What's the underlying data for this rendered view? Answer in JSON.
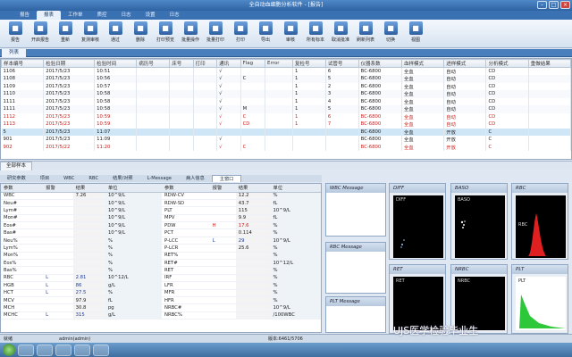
{
  "window": {
    "title": "全自动血细胞分析软件 - [报告]",
    "min": "–",
    "max": "□",
    "close": "×"
  },
  "menus": [
    {
      "label": "报告"
    },
    {
      "label": "报表"
    },
    {
      "label": "工作单"
    },
    {
      "label": "质控"
    },
    {
      "label": "日志"
    },
    {
      "label": "设置"
    },
    {
      "label": "日志"
    }
  ],
  "toolbar": [
    {
      "label": "报告",
      "icon": "report-icon"
    },
    {
      "label": "开启报告",
      "icon": "open-report-icon"
    },
    {
      "label": "重新",
      "icon": "refresh-icon"
    },
    {
      "label": "复测审核",
      "icon": "review-icon"
    },
    {
      "label": "通过",
      "icon": "approve-icon"
    },
    {
      "label": "删除",
      "icon": "delete-icon"
    },
    {
      "label": "打印预览",
      "icon": "print-preview-icon"
    },
    {
      "label": "批量操作",
      "icon": "batch-icon"
    },
    {
      "label": "批量打印",
      "icon": "batch-print-icon"
    },
    {
      "label": "打印",
      "icon": "print-icon"
    },
    {
      "label": "导出",
      "icon": "export-icon"
    },
    {
      "label": "审核",
      "icon": "audit-icon"
    },
    {
      "label": "所有标本",
      "icon": "all-samples-icon"
    },
    {
      "label": "取消批准",
      "icon": "cancel-approve-icon"
    },
    {
      "label": "刷新列表",
      "icon": "refresh-list-icon"
    },
    {
      "label": "切换",
      "icon": "switch-icon"
    },
    {
      "label": "视图",
      "icon": "view-icon"
    }
  ],
  "list_tab": "列表",
  "grid": {
    "columns": [
      "样本编号",
      "检验日期",
      "检验时间",
      "病历号",
      "床号",
      "打印",
      "通讯",
      "Flag",
      "Error",
      "复检号",
      "试管号",
      "仪器系数",
      "血样模式",
      "进样模式",
      "分析模式",
      "重做结果"
    ],
    "rows": [
      {
        "cells": [
          "1106",
          "2017/5/23",
          "10:51",
          "",
          "",
          "",
          "√",
          "",
          "",
          "1",
          "6",
          "BC-6800",
          "全血",
          "自动",
          "CD",
          ""
        ],
        "style": "normal"
      },
      {
        "cells": [
          "1108",
          "2017/5/23",
          "10:56",
          "",
          "",
          "",
          "√",
          "C",
          "",
          "1",
          "5",
          "BC-6800",
          "全血",
          "自动",
          "CD",
          ""
        ],
        "style": "alt"
      },
      {
        "cells": [
          "1109",
          "2017/5/23",
          "10:57",
          "",
          "",
          "",
          "√",
          "",
          "",
          "1",
          "2",
          "BC-6800",
          "全血",
          "自动",
          "CD",
          ""
        ],
        "style": "normal"
      },
      {
        "cells": [
          "1110",
          "2017/5/23",
          "10:58",
          "",
          "",
          "",
          "√",
          "",
          "",
          "1",
          "3",
          "BC-6800",
          "全血",
          "自动",
          "CD",
          ""
        ],
        "style": "alt"
      },
      {
        "cells": [
          "1111",
          "2017/5/23",
          "10:58",
          "",
          "",
          "",
          "√",
          "",
          "",
          "1",
          "4",
          "BC-6800",
          "全血",
          "自动",
          "CD",
          ""
        ],
        "style": "normal"
      },
      {
        "cells": [
          "1111",
          "2017/5/23",
          "10:58",
          "",
          "",
          "",
          "√",
          "M",
          "",
          "1",
          "5",
          "BC-6800",
          "全血",
          "自动",
          "CD",
          ""
        ],
        "style": "alt"
      },
      {
        "cells": [
          "1112",
          "2017/5/23",
          "10:59",
          "",
          "",
          "",
          "√",
          "C",
          "",
          "1",
          "6",
          "BC-6800",
          "全血",
          "自动",
          "CD",
          ""
        ],
        "style": "red"
      },
      {
        "cells": [
          "1113",
          "2017/5/23",
          "10:59",
          "",
          "",
          "",
          "√",
          "CD",
          "",
          "1",
          "7",
          "BC-6800",
          "全血",
          "自动",
          "CD",
          ""
        ],
        "style": "red"
      },
      {
        "cells": [
          "5",
          "2017/5/23",
          "11:07",
          "",
          "",
          "",
          "",
          "",
          "",
          "",
          "",
          "BC-6800",
          "全血",
          "开放",
          "C",
          ""
        ],
        "style": "sel"
      },
      {
        "cells": [
          "901",
          "2017/5/23",
          "11:09",
          "",
          "",
          "",
          "√",
          "",
          "",
          "",
          "",
          "BC-6800",
          "全血",
          "开放",
          "C",
          ""
        ],
        "style": "normal"
      },
      {
        "cells": [
          "902",
          "2017/5/22",
          "11:20",
          "",
          "",
          "",
          "√",
          "C",
          "",
          "",
          "",
          "BC-6800",
          "全血",
          "开放",
          "C",
          ""
        ],
        "style": "red"
      }
    ]
  },
  "bottom_tab": "全部样本",
  "sub_tabs": [
    {
      "label": "研究参数"
    },
    {
      "label": "项目"
    },
    {
      "label": "WBC"
    },
    {
      "label": "RBC"
    },
    {
      "label": "结果/对照"
    },
    {
      "label": "L-Message"
    },
    {
      "label": "病人信息"
    },
    {
      "label": "主窗口"
    }
  ],
  "results": {
    "left_headers": [
      "参数",
      "报警",
      "结果",
      "单位"
    ],
    "left": [
      [
        "WBC",
        "",
        "7.26",
        "10^9/L"
      ],
      [
        "Neu#",
        "",
        "",
        "10^9/L"
      ],
      [
        "Lym#",
        "",
        "",
        "10^9/L"
      ],
      [
        "Mon#",
        "",
        "",
        "10^9/L"
      ],
      [
        "Eos#",
        "",
        "",
        "10^9/L"
      ],
      [
        "Bas#",
        "",
        "",
        "10^9/L"
      ],
      [
        "Neu%",
        "",
        "",
        "%"
      ],
      [
        "Lym%",
        "",
        "",
        "%"
      ],
      [
        "Mon%",
        "",
        "",
        "%"
      ],
      [
        "Eos%",
        "",
        "",
        "%"
      ],
      [
        "Bas%",
        "",
        "",
        "%"
      ],
      [
        "RBC",
        "L",
        "2.81",
        "10^12/L"
      ],
      [
        "HGB",
        "L",
        "86",
        "g/L"
      ],
      [
        "HCT",
        "L",
        "27.5",
        "%"
      ],
      [
        "MCV",
        "",
        "97.9",
        "fL"
      ],
      [
        "MCH",
        "",
        "30.8",
        "pg"
      ],
      [
        "MCHC",
        "L",
        "315",
        "g/L"
      ]
    ],
    "right_headers": [
      "参数",
      "报警",
      "结果",
      "单位"
    ],
    "right": [
      [
        "RDW-CV",
        "",
        "12.2",
        "%"
      ],
      [
        "RDW-SD",
        "",
        "43.7",
        "fL"
      ],
      [
        "PLT",
        "",
        "115",
        "10^9/L"
      ],
      [
        "MPV",
        "",
        "9.9",
        "fL"
      ],
      [
        "PDW",
        "H",
        "17.6",
        "%"
      ],
      [
        "PCT",
        "",
        "0.114",
        "%"
      ],
      [
        "P-LCC",
        "L",
        "29",
        "10^9/L"
      ],
      [
        "P-LCR",
        "",
        "25.6",
        "%"
      ],
      [
        "RET%",
        "",
        "",
        "%"
      ],
      [
        "RET#",
        "",
        "",
        "10^12/L"
      ],
      [
        "RET",
        "",
        "",
        "%"
      ],
      [
        "IRF",
        "",
        "",
        "%"
      ],
      [
        "LFR",
        "",
        "",
        "%"
      ],
      [
        "MFR",
        "",
        "",
        "%"
      ],
      [
        "HFR",
        "",
        "",
        "%"
      ],
      [
        "NRBC#",
        "",
        "",
        "10^9/L"
      ],
      [
        "NRBC%",
        "",
        "",
        "/100WBC"
      ]
    ]
  },
  "messages": [
    "WBC Message",
    "RBC Message",
    "PLT Message"
  ],
  "scatter": [
    {
      "title": "DIFF",
      "plot": "DIFF"
    },
    {
      "title": "BASO",
      "plot": "BASO"
    },
    {
      "title": "RBC",
      "plot": "RBC"
    },
    {
      "title": "RET",
      "plot": "RET"
    },
    {
      "title": "NRBC",
      "plot": "NRBC"
    },
    {
      "title": "PLT",
      "plot": "PLT"
    }
  ],
  "status": {
    "left": "就绪",
    "user": "admin(admin)",
    "right": "版本:6461/5706"
  },
  "watermark": "UJS医学检验毕业生"
}
